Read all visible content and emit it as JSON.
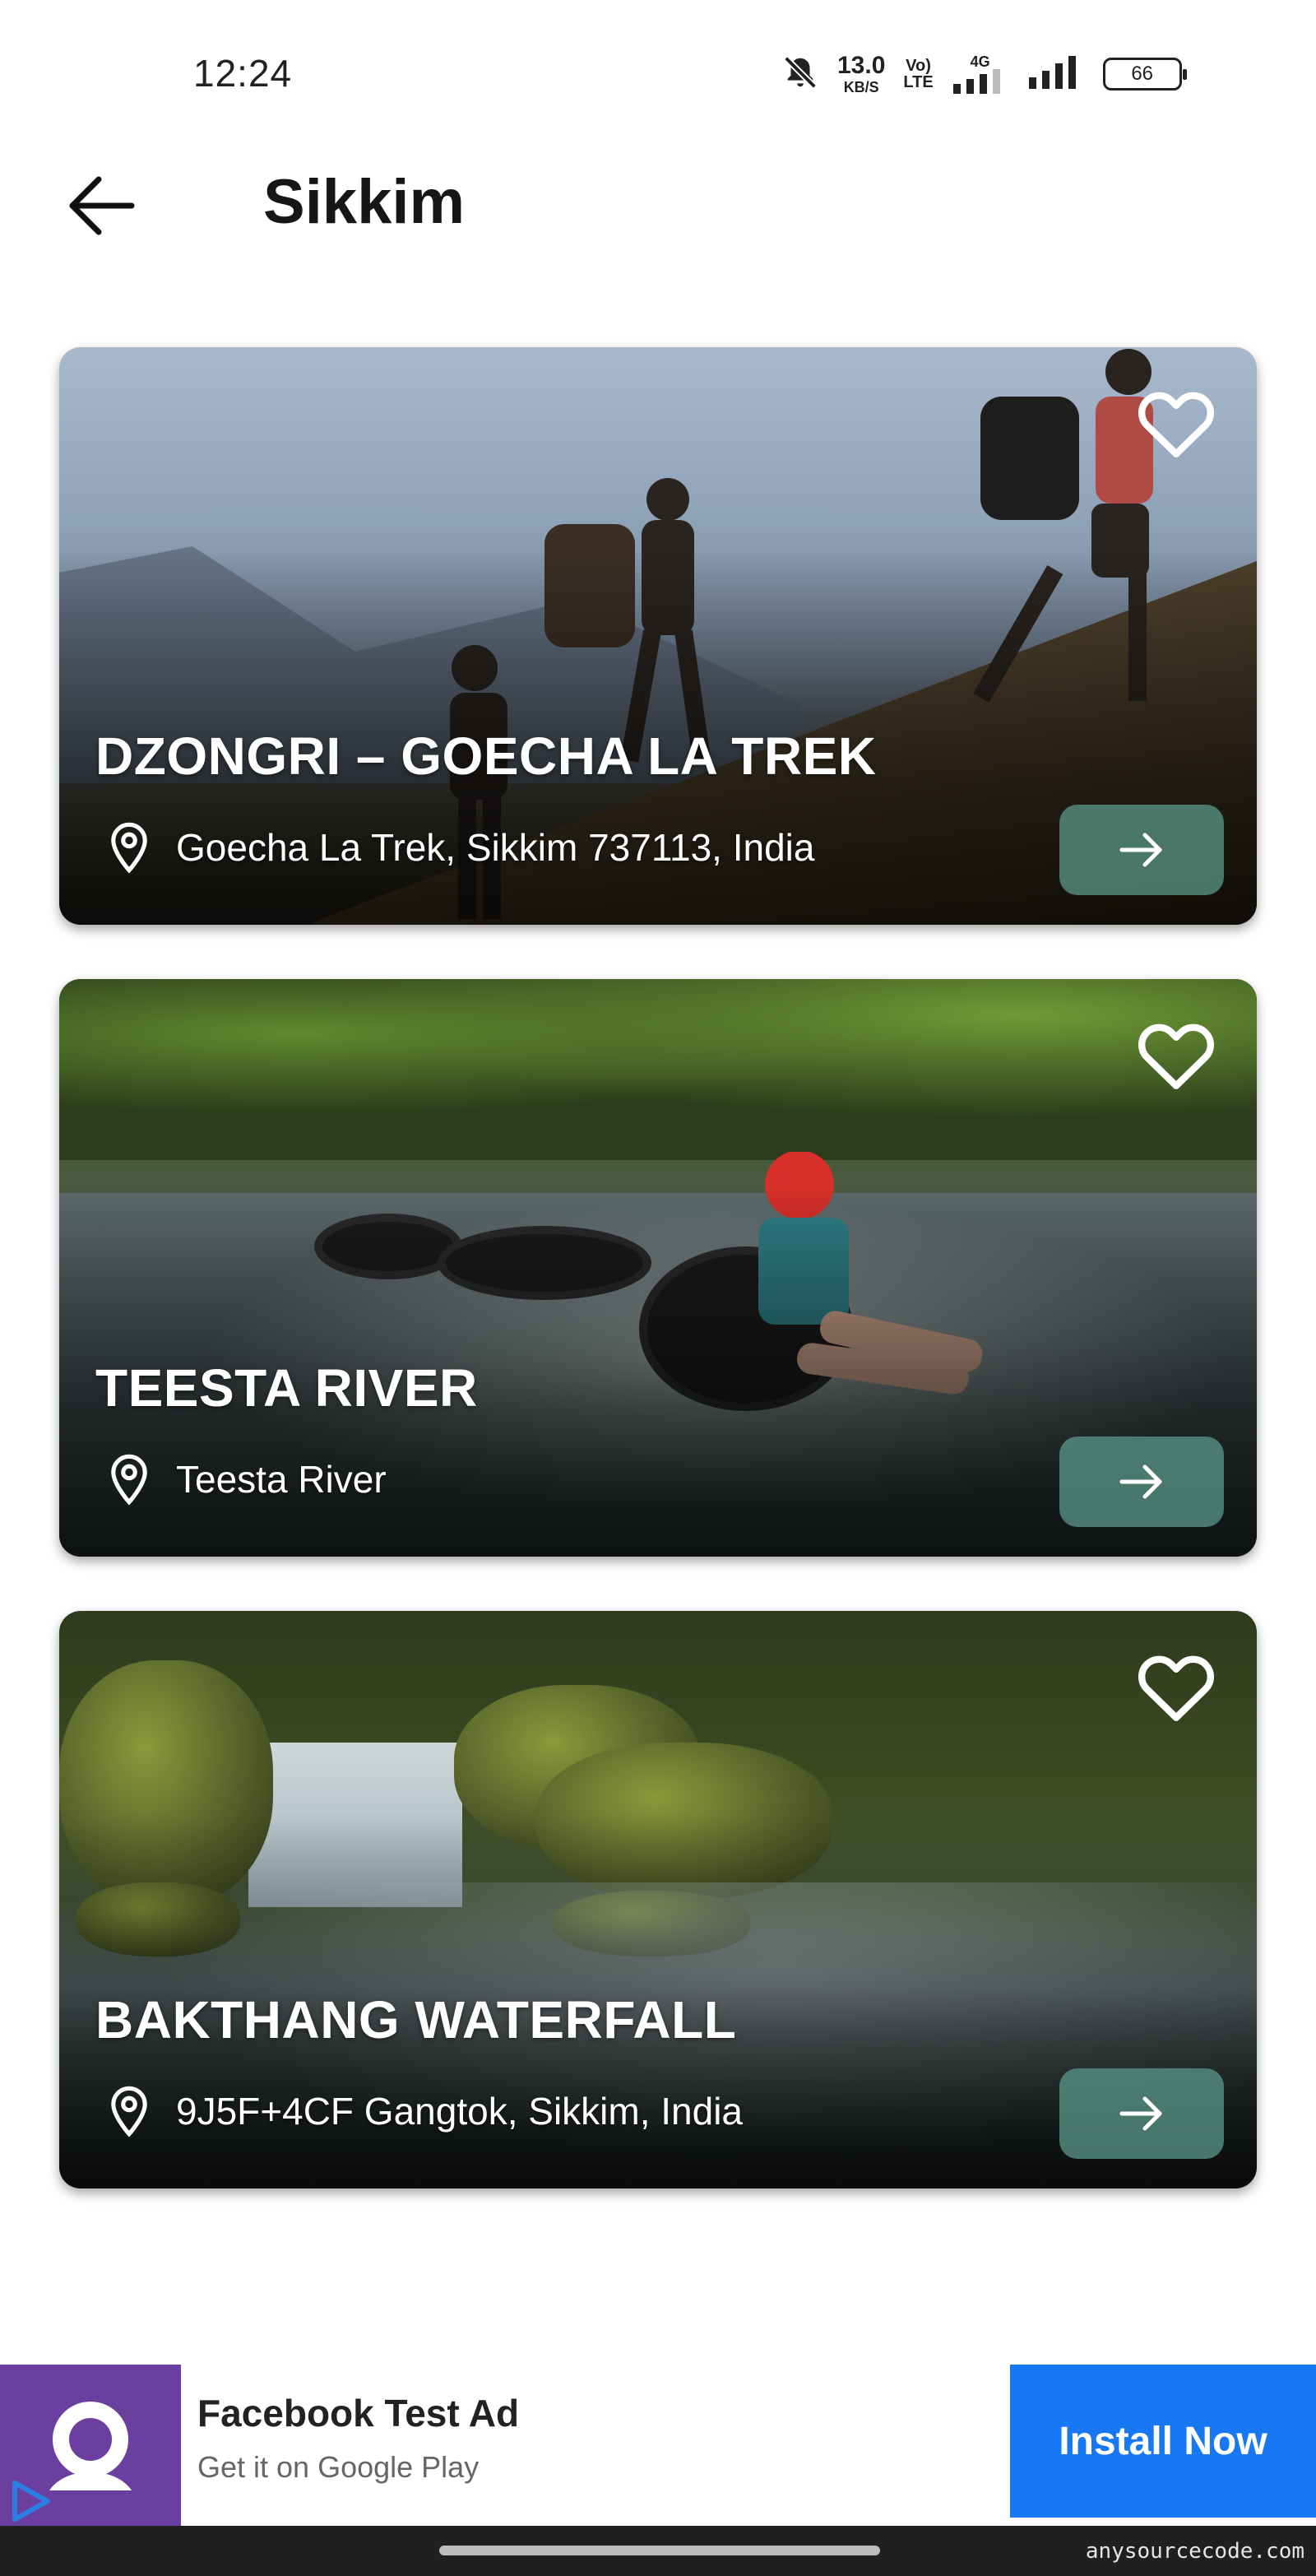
{
  "status_bar": {
    "time": "12:24",
    "net_speed_value": "13.0",
    "net_speed_unit": "KB/S",
    "volte_top": "Vo)",
    "volte_bottom": "LTE",
    "network_type": "4G",
    "battery": "66",
    "icons": [
      "mute-bell-icon",
      "signal-icon",
      "signal-icon",
      "battery-icon"
    ]
  },
  "header": {
    "back_icon": "arrow-left-icon",
    "title": "Sikkim"
  },
  "places": [
    {
      "title": "DZONGRI – GOECHA LA TREK",
      "location": "Goecha La Trek, Sikkim 737113, India",
      "favorite": false
    },
    {
      "title": "TEESTA RIVER",
      "location": "Teesta River",
      "favorite": false
    },
    {
      "title": "BAKTHANG WATERFALL",
      "location": "9J5F+4CF Gangtok, Sikkim, India",
      "favorite": false
    }
  ],
  "card_icons": {
    "favorite": "heart-outline-icon",
    "location": "map-pin-icon",
    "open": "arrow-right-icon"
  },
  "ad": {
    "title": "Facebook Test Ad",
    "subtitle": "Get it on Google Play",
    "cta": "Install Now",
    "brand_color": "#1877f2",
    "logo_color": "#6a3fa0"
  },
  "accent_button_color": "#589484",
  "watermark": "anysourcecode.com"
}
